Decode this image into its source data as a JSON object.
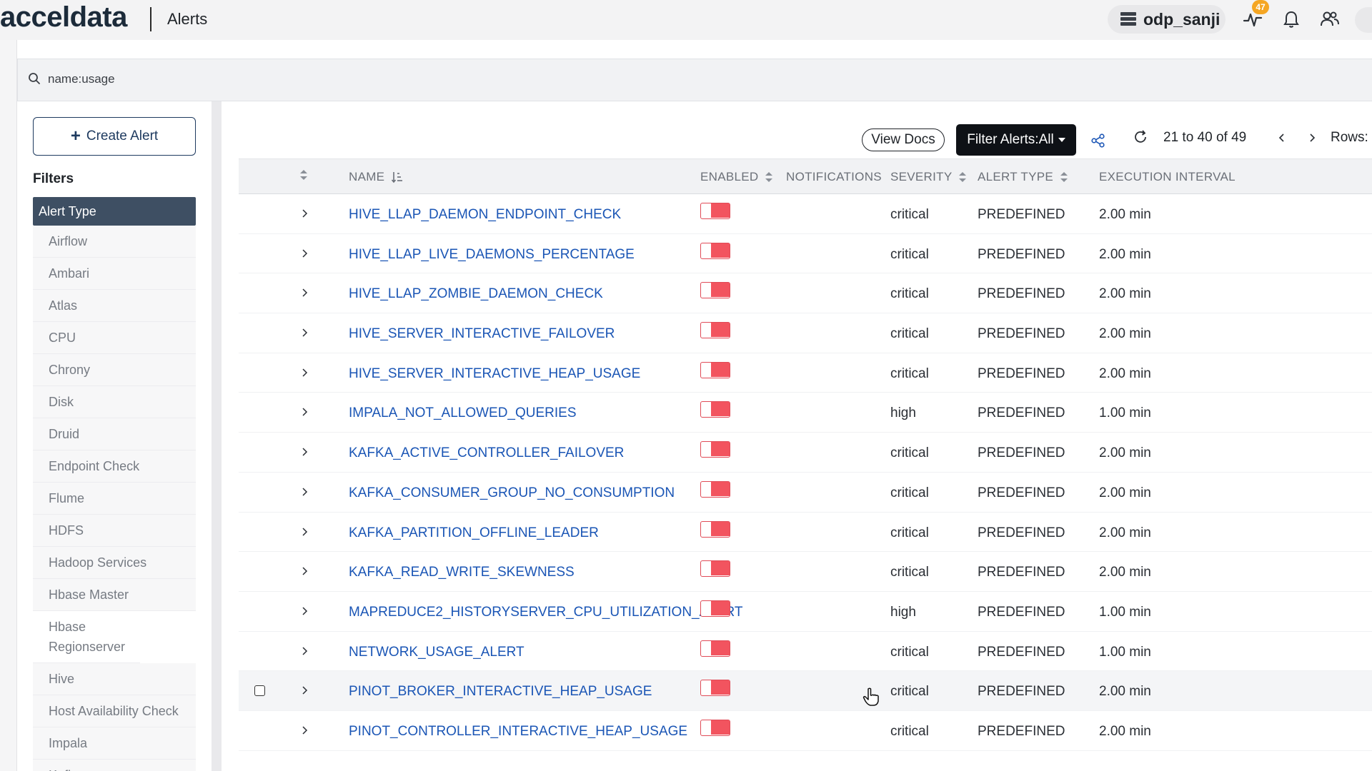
{
  "app": {
    "logo_text": "acceldata",
    "page_title": "Alerts",
    "username": "odp_sanji",
    "activity_badge_count": "47"
  },
  "search": {
    "query": "name:usage"
  },
  "sidebar": {
    "create_button_label": "Create Alert",
    "filters_title": "Filters",
    "group_header": "Alert Type",
    "items": [
      "Airflow",
      "Ambari",
      "Atlas",
      "CPU",
      "Chrony",
      "Disk",
      "Druid",
      "Endpoint Check",
      "Flume",
      "HDFS",
      "Hadoop Services",
      "Hbase Master",
      "Hbase Regionserver",
      "Hive",
      "Host Availability Check",
      "Impala",
      "Kafka"
    ]
  },
  "toolbar": {
    "view_docs_label": "View Docs",
    "filter_alerts_label": "Filter Alerts:All",
    "pagination_text": "21 to 40 of 49",
    "rows_label": "Rows:"
  },
  "table": {
    "headers": {
      "name": "NAME",
      "enabled": "ENABLED",
      "notifications": "NOTIFICATIONS",
      "severity": "SEVERITY",
      "alert_type": "ALERT TYPE",
      "execution_interval": "EXECUTION INTERVAL"
    },
    "rows": [
      {
        "name": "HIVE_LLAP_DAEMON_ENDPOINT_CHECK",
        "severity": "critical",
        "type": "PREDEFINED",
        "interval": "2.00 min"
      },
      {
        "name": "HIVE_LLAP_LIVE_DAEMONS_PERCENTAGE",
        "severity": "critical",
        "type": "PREDEFINED",
        "interval": "2.00 min"
      },
      {
        "name": "HIVE_LLAP_ZOMBIE_DAEMON_CHECK",
        "severity": "critical",
        "type": "PREDEFINED",
        "interval": "2.00 min"
      },
      {
        "name": "HIVE_SERVER_INTERACTIVE_FAILOVER",
        "severity": "critical",
        "type": "PREDEFINED",
        "interval": "2.00 min"
      },
      {
        "name": "HIVE_SERVER_INTERACTIVE_HEAP_USAGE",
        "severity": "critical",
        "type": "PREDEFINED",
        "interval": "2.00 min"
      },
      {
        "name": "IMPALA_NOT_ALLOWED_QUERIES",
        "severity": "high",
        "type": "PREDEFINED",
        "interval": "1.00 min"
      },
      {
        "name": "KAFKA_ACTIVE_CONTROLLER_FAILOVER",
        "severity": "critical",
        "type": "PREDEFINED",
        "interval": "2.00 min"
      },
      {
        "name": "KAFKA_CONSUMER_GROUP_NO_CONSUMPTION",
        "severity": "critical",
        "type": "PREDEFINED",
        "interval": "2.00 min"
      },
      {
        "name": "KAFKA_PARTITION_OFFLINE_LEADER",
        "severity": "critical",
        "type": "PREDEFINED",
        "interval": "2.00 min"
      },
      {
        "name": "KAFKA_READ_WRITE_SKEWNESS",
        "severity": "critical",
        "type": "PREDEFINED",
        "interval": "2.00 min"
      },
      {
        "name": "MAPREDUCE2_HISTORYSERVER_CPU_UTILIZATION_ALERT",
        "severity": "high",
        "type": "PREDEFINED",
        "interval": "1.00 min"
      },
      {
        "name": "NETWORK_USAGE_ALERT",
        "severity": "critical",
        "type": "PREDEFINED",
        "interval": "1.00 min"
      },
      {
        "name": "PINOT_BROKER_INTERACTIVE_HEAP_USAGE",
        "severity": "critical",
        "type": "PREDEFINED",
        "interval": "2.00 min"
      },
      {
        "name": "PINOT_CONTROLLER_INTERACTIVE_HEAP_USAGE",
        "severity": "critical",
        "type": "PREDEFINED",
        "interval": "2.00 min"
      }
    ]
  },
  "colors": {
    "link": "#1a55b5",
    "toggle_off": "#f2545f",
    "sidebar_header": "#3e4f63",
    "badge": "#f5a623"
  },
  "icons": [
    "search-icon",
    "db-icon",
    "activity-icon",
    "bell-icon",
    "users-icon",
    "plus-icon",
    "share-icon",
    "refresh-icon",
    "chevron-left-icon",
    "chevron-right-icon",
    "sort-icon",
    "chevron-right-icon",
    "hand-cursor-icon"
  ]
}
